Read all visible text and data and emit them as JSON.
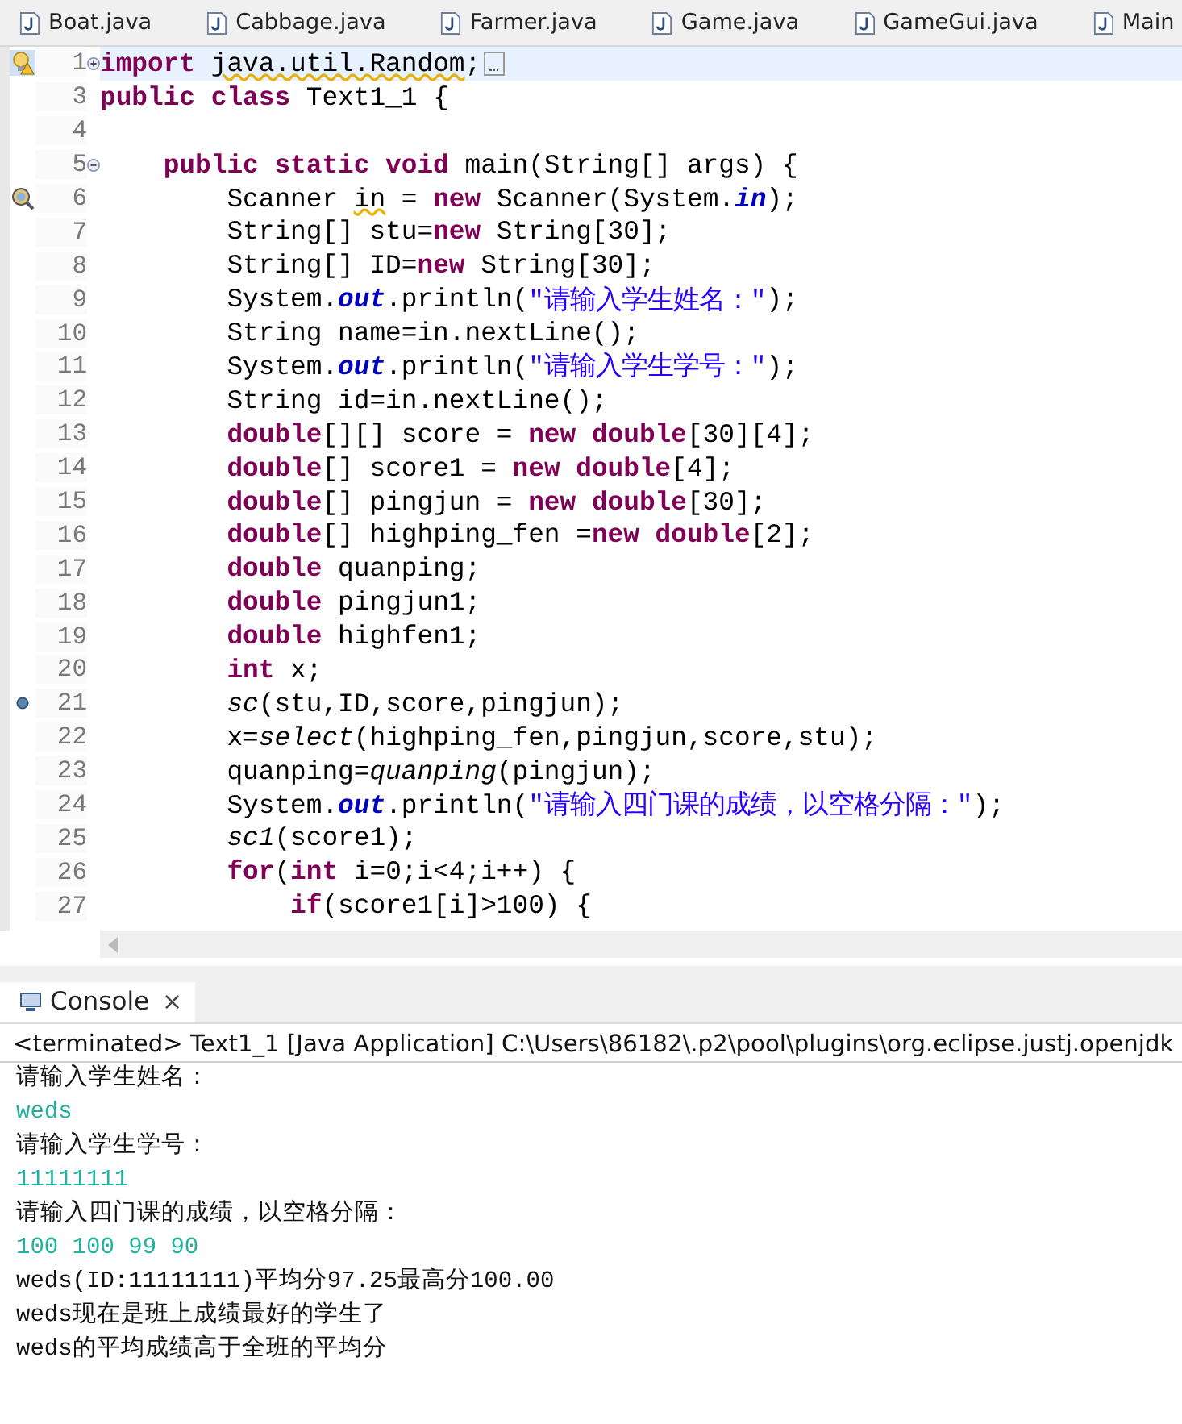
{
  "tabs": [
    {
      "label": "Boat.java",
      "selected": false
    },
    {
      "label": "Cabbage.java",
      "selected": false
    },
    {
      "label": "Farmer.java",
      "selected": false
    },
    {
      "label": "Game.java",
      "selected": false
    },
    {
      "label": "GameGui.java",
      "selected": false
    },
    {
      "label": "Main",
      "selected": false
    }
  ],
  "editor": {
    "lines": [
      {
        "number": "1",
        "selected": true,
        "marker": {
          "kind": "warning"
        },
        "fold": {
          "kind": "expand"
        },
        "folded_box": true,
        "tokens": [
          {
            "kind": "k",
            "text": "import "
          },
          {
            "kind": "w",
            "text": "java.util.Random"
          },
          {
            "kind": "t",
            "text": ";"
          }
        ]
      },
      {
        "number": "3",
        "selected": false,
        "tokens": [
          {
            "kind": "k",
            "text": "public class"
          },
          {
            "kind": "t",
            "text": " Text1_1 {"
          }
        ]
      },
      {
        "number": "4",
        "selected": false
      },
      {
        "number": "5",
        "selected": false,
        "fold": {
          "kind": "collapse"
        },
        "tokens": [
          {
            "kind": "k",
            "text": "    public static void"
          },
          {
            "kind": "t",
            "text": " main(String[] args) {"
          }
        ]
      },
      {
        "number": "6",
        "selected": false,
        "marker": {
          "kind": "search"
        },
        "tokens": [
          {
            "kind": "t",
            "text": "        Scanner "
          },
          {
            "kind": "w",
            "text": "in"
          },
          {
            "kind": "t",
            "text": " = "
          },
          {
            "kind": "k",
            "text": "new"
          },
          {
            "kind": "t",
            "text": " Scanner(System."
          },
          {
            "kind": "f",
            "text": "in"
          },
          {
            "kind": "t",
            "text": ");"
          }
        ]
      },
      {
        "number": "7",
        "selected": false,
        "tokens": [
          {
            "kind": "t",
            "text": "        String[] stu="
          },
          {
            "kind": "k",
            "text": "new"
          },
          {
            "kind": "t",
            "text": " String[30];"
          }
        ]
      },
      {
        "number": "8",
        "selected": false,
        "tokens": [
          {
            "kind": "t",
            "text": "        String[] ID="
          },
          {
            "kind": "k",
            "text": "new"
          },
          {
            "kind": "t",
            "text": " String[30];"
          }
        ]
      },
      {
        "number": "9",
        "selected": false,
        "tokens": [
          {
            "kind": "t",
            "text": "        System."
          },
          {
            "kind": "f",
            "text": "out"
          },
          {
            "kind": "t",
            "text": ".println("
          },
          {
            "kind": "s",
            "text": "\"请输入学生姓名：\""
          },
          {
            "kind": "t",
            "text": ");"
          }
        ]
      },
      {
        "number": "10",
        "selected": false,
        "tokens": [
          {
            "kind": "t",
            "text": "        String name=in.nextLine();"
          }
        ]
      },
      {
        "number": "11",
        "selected": false,
        "tokens": [
          {
            "kind": "t",
            "text": "        System."
          },
          {
            "kind": "f",
            "text": "out"
          },
          {
            "kind": "t",
            "text": ".println("
          },
          {
            "kind": "s",
            "text": "\"请输入学生学号：\""
          },
          {
            "kind": "t",
            "text": ");"
          }
        ]
      },
      {
        "number": "12",
        "selected": false,
        "tokens": [
          {
            "kind": "t",
            "text": "        String id=in.nextLine();"
          }
        ]
      },
      {
        "number": "13",
        "selected": false,
        "tokens": [
          {
            "kind": "k",
            "text": "        double"
          },
          {
            "kind": "t",
            "text": "[][] score = "
          },
          {
            "kind": "k",
            "text": "new double"
          },
          {
            "kind": "t",
            "text": "[30][4];"
          }
        ]
      },
      {
        "number": "14",
        "selected": false,
        "tokens": [
          {
            "kind": "k",
            "text": "        double"
          },
          {
            "kind": "t",
            "text": "[] score1 = "
          },
          {
            "kind": "k",
            "text": "new double"
          },
          {
            "kind": "t",
            "text": "[4];"
          }
        ]
      },
      {
        "number": "15",
        "selected": false,
        "tokens": [
          {
            "kind": "k",
            "text": "        double"
          },
          {
            "kind": "t",
            "text": "[] pingjun = "
          },
          {
            "kind": "k",
            "text": "new double"
          },
          {
            "kind": "t",
            "text": "[30];"
          }
        ]
      },
      {
        "number": "16",
        "selected": false,
        "tokens": [
          {
            "kind": "k",
            "text": "        double"
          },
          {
            "kind": "t",
            "text": "[] highping_fen ="
          },
          {
            "kind": "k",
            "text": "new double"
          },
          {
            "kind": "t",
            "text": "[2];"
          }
        ]
      },
      {
        "number": "17",
        "selected": false,
        "tokens": [
          {
            "kind": "k",
            "text": "        double"
          },
          {
            "kind": "t",
            "text": " quanping;"
          }
        ]
      },
      {
        "number": "18",
        "selected": false,
        "tokens": [
          {
            "kind": "k",
            "text": "        double"
          },
          {
            "kind": "t",
            "text": " pingjun1;"
          }
        ]
      },
      {
        "number": "19",
        "selected": false,
        "tokens": [
          {
            "kind": "k",
            "text": "        double"
          },
          {
            "kind": "t",
            "text": " highfen1;"
          }
        ]
      },
      {
        "number": "20",
        "selected": false,
        "tokens": [
          {
            "kind": "k",
            "text": "        int"
          },
          {
            "kind": "t",
            "text": " x;"
          }
        ]
      },
      {
        "number": "21",
        "selected": false,
        "marker": {
          "kind": "dot"
        },
        "tokens": [
          {
            "kind": "m",
            "text": "        sc"
          },
          {
            "kind": "t",
            "text": "(stu,ID,score,pingjun);"
          }
        ]
      },
      {
        "number": "22",
        "selected": false,
        "tokens": [
          {
            "kind": "t",
            "text": "        x="
          },
          {
            "kind": "m",
            "text": "select"
          },
          {
            "kind": "t",
            "text": "(highping_fen,pingjun,score,stu);"
          }
        ]
      },
      {
        "number": "23",
        "selected": false,
        "tokens": [
          {
            "kind": "t",
            "text": "        quanping="
          },
          {
            "kind": "m",
            "text": "quanping"
          },
          {
            "kind": "t",
            "text": "(pingjun);"
          }
        ]
      },
      {
        "number": "24",
        "selected": false,
        "tokens": [
          {
            "kind": "t",
            "text": "        System."
          },
          {
            "kind": "f",
            "text": "out"
          },
          {
            "kind": "t",
            "text": ".println("
          },
          {
            "kind": "s",
            "text": "\"请输入四门课的成绩，以空格分隔：\""
          },
          {
            "kind": "t",
            "text": ");"
          }
        ]
      },
      {
        "number": "25",
        "selected": false,
        "tokens": [
          {
            "kind": "m",
            "text": "        sc1"
          },
          {
            "kind": "t",
            "text": "(score1);"
          }
        ]
      },
      {
        "number": "26",
        "selected": false,
        "tokens": [
          {
            "kind": "k",
            "text": "        for"
          },
          {
            "kind": "t",
            "text": "("
          },
          {
            "kind": "k",
            "text": "int"
          },
          {
            "kind": "t",
            "text": " i=0;i<4;i++) {"
          }
        ]
      },
      {
        "number": "27",
        "selected": false,
        "tokens": [
          {
            "kind": "k",
            "text": "            if"
          },
          {
            "kind": "t",
            "text": "(score1[i]>100) {"
          }
        ]
      }
    ]
  },
  "console": {
    "tab": {
      "label": "Console",
      "close": "×"
    },
    "header": "<terminated> Text1_1 [Java Application] C:\\Users\\86182\\.p2\\pool\\plugins\\org.eclipse.justj.openjdk",
    "lines": [
      {
        "kind": "output",
        "text": "请输入学生姓名："
      },
      {
        "kind": "input",
        "text": "weds"
      },
      {
        "kind": "output",
        "text": "请输入学生学号："
      },
      {
        "kind": "input",
        "text": "11111111"
      },
      {
        "kind": "output",
        "text": "请输入四门课的成绩，以空格分隔："
      },
      {
        "kind": "input",
        "text": "100 100 99 90"
      },
      {
        "kind": "output",
        "text": "weds(ID:11111111)平均分97.25最高分100.00"
      },
      {
        "kind": "output",
        "text": "weds现在是班上成绩最好的学生了"
      },
      {
        "kind": "output",
        "text": "weds的平均成绩高于全班的平均分"
      }
    ]
  }
}
